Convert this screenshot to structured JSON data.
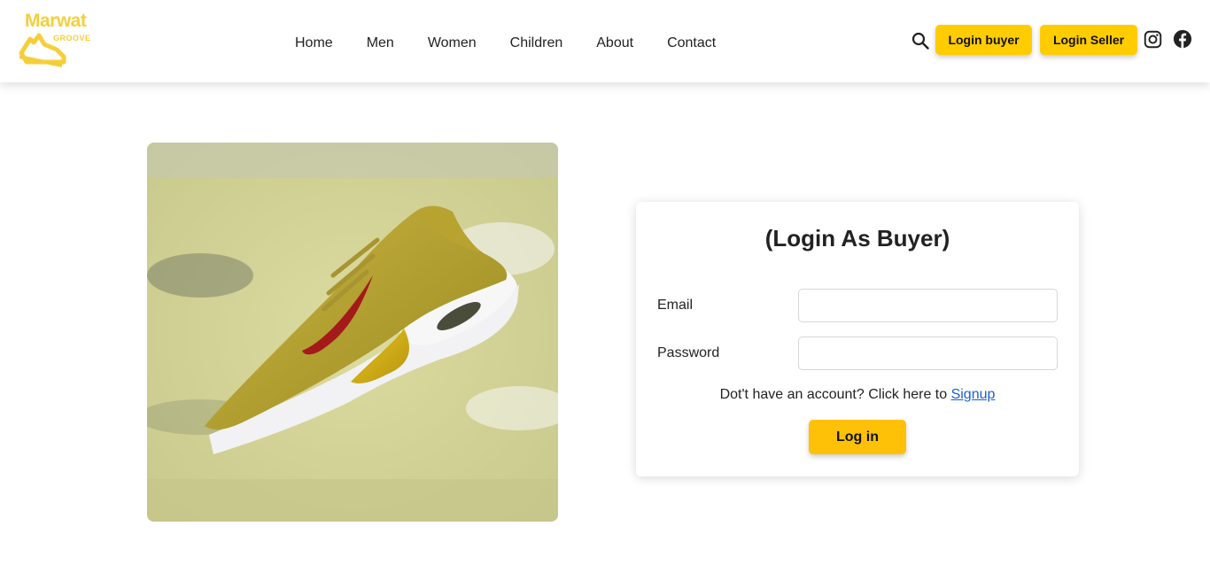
{
  "brand": {
    "line1": "Marwat",
    "line2": "GROOVE",
    "color": "#f5cf3a"
  },
  "nav": {
    "items": [
      "Home",
      "Men",
      "Women",
      "Children",
      "About",
      "Contact"
    ]
  },
  "header_actions": {
    "login_buyer": "Login buyer",
    "login_seller": "Login Seller",
    "icons": [
      "search-icon",
      "instagram-icon",
      "facebook-icon"
    ],
    "accent": "#ffcc00"
  },
  "hero": {
    "image": "shoe-photo"
  },
  "login": {
    "title": "(Login As Buyer)",
    "email_label": "Email",
    "email_value": "",
    "password_label": "Password",
    "password_value": "",
    "signup_prompt": "Dot't have an account? Click here to",
    "signup_link": "Signup",
    "submit": "Log in",
    "button_color": "#ffc107"
  }
}
